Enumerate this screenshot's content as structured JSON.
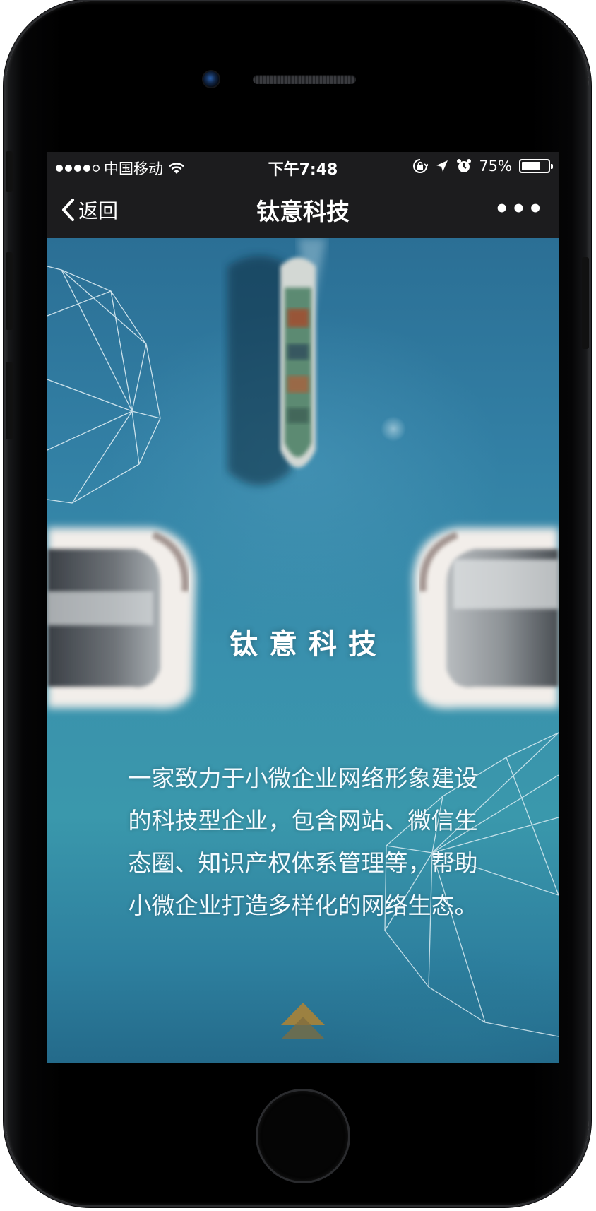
{
  "status_bar": {
    "carrier": "中国移动",
    "time": "下午7:48",
    "battery_percent": "75%",
    "battery_level": 0.75
  },
  "nav": {
    "back_label": "返回",
    "title": "钛意科技",
    "more_label": "•••"
  },
  "hero": {
    "title": "钛意科技",
    "description": "一家致力于小微企业网络形象建设的科技型企业，包含网站、微信生态圈、知识产权体系管理等，帮助小微企业打造多样化的网络生态。"
  },
  "icons": {
    "back": "chevron-left-icon",
    "wifi": "wifi-icon",
    "lock_rotation": "lock-rotation-icon",
    "location": "location-arrow-icon",
    "alarm": "alarm-clock-icon",
    "battery": "battery-icon",
    "scroll_up": "double-chevron-up-icon"
  },
  "colors": {
    "nav_background": "#1c1c1e",
    "content_background": "#3990ad",
    "accent_gold": "#9c7a3c"
  }
}
